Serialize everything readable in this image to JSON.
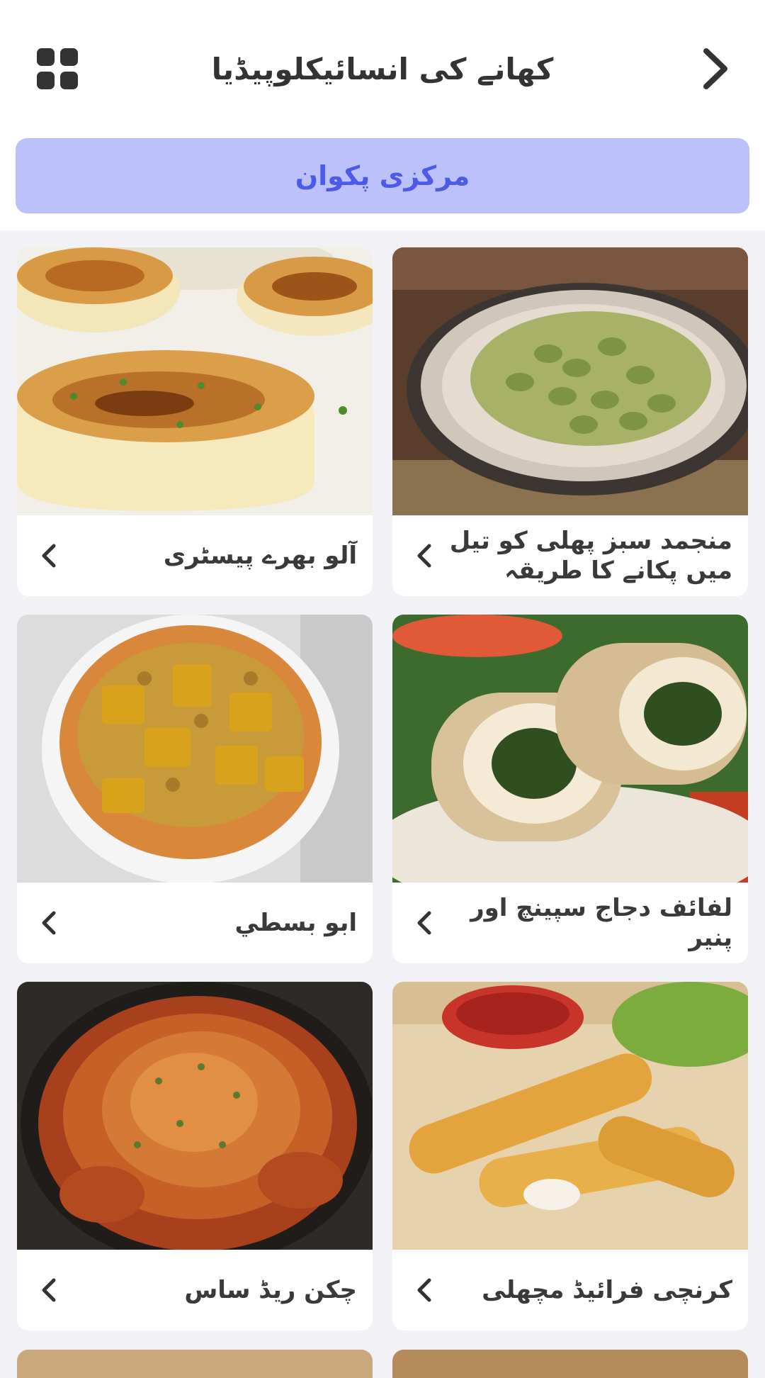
{
  "header": {
    "title": "کھانے کی انسائیکلوپیڈیا",
    "menu_icon": "grid-icon",
    "back_icon": "chevron-right-icon"
  },
  "category": {
    "label": "مرکزی پکوان"
  },
  "recipes": [
    {
      "title": "آلو بھرے پیسٹری",
      "icon": "chevron-left-icon"
    },
    {
      "title": "منجمد سبز پھلی کو تیل میں پکانے کا طریقہ",
      "icon": "chevron-left-icon"
    },
    {
      "title": "ابو بسطي",
      "icon": "chevron-left-icon"
    },
    {
      "title": "لفائف دجاج سپینچ اور پنیر",
      "icon": "chevron-left-icon"
    },
    {
      "title": "چکن ریڈ ساس",
      "icon": "chevron-left-icon"
    },
    {
      "title": "کرنچی فرائیڈ مچھلی",
      "icon": "chevron-left-icon"
    }
  ],
  "colors": {
    "accent_bg": "#bcc1fb",
    "accent_text": "#4d59e9",
    "page_bg": "#f1f1f6"
  }
}
